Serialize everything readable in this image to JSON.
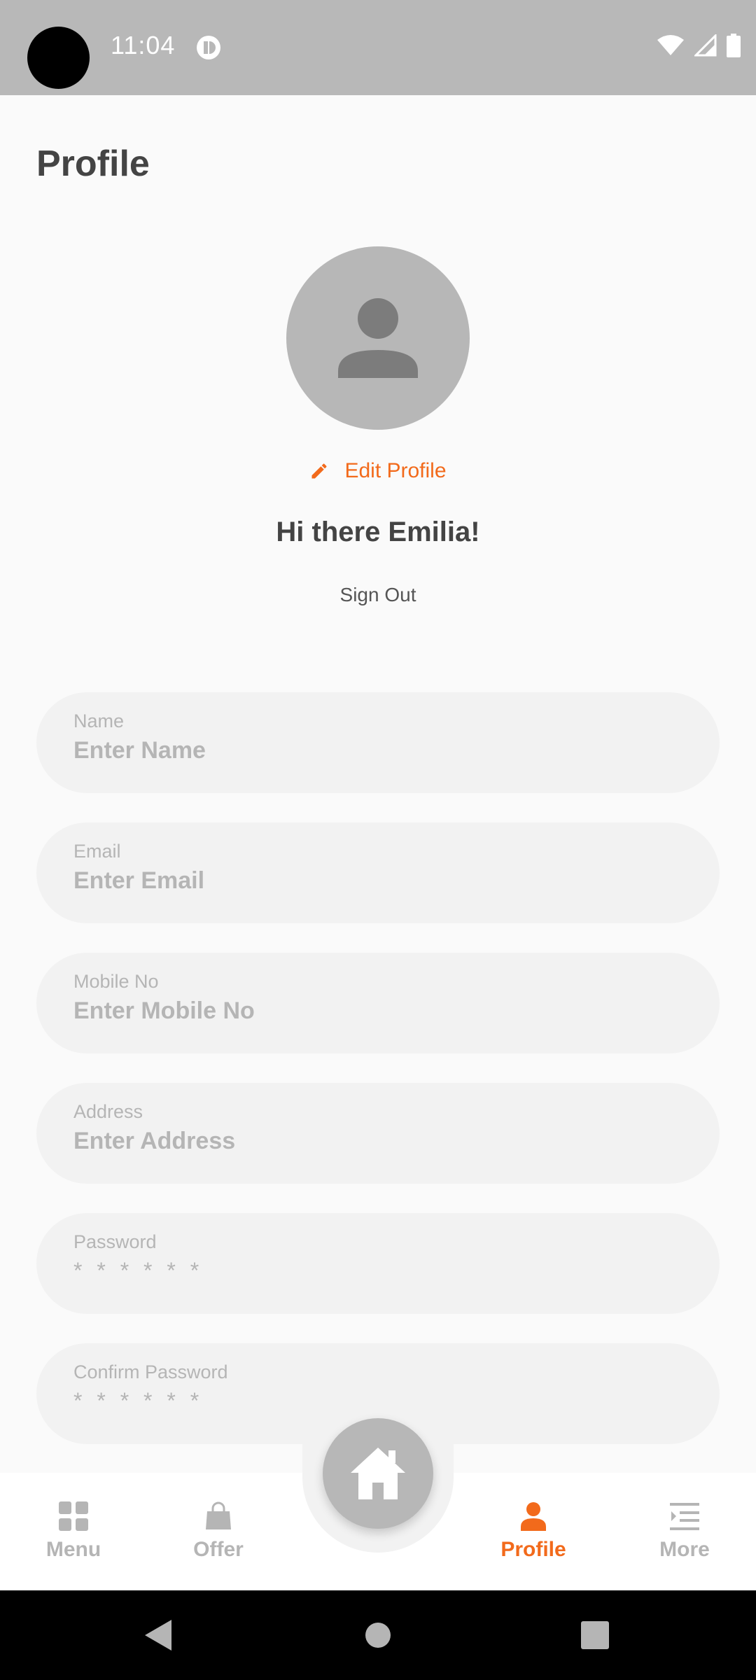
{
  "status_bar": {
    "time": "11:04"
  },
  "header": {
    "title": "Profile"
  },
  "profile": {
    "edit_label": "Edit Profile",
    "greeting": "Hi there Emilia!",
    "sign_out": "Sign Out"
  },
  "form": {
    "fields": [
      {
        "label": "Name",
        "placeholder": "Enter Name"
      },
      {
        "label": "Email",
        "placeholder": "Enter Email"
      },
      {
        "label": "Mobile No",
        "placeholder": "Enter Mobile No"
      },
      {
        "label": "Address",
        "placeholder": "Enter Address"
      },
      {
        "label": "Password",
        "value": "* * * * * *"
      },
      {
        "label": "Confirm Password",
        "value": "* * * * * *"
      }
    ]
  },
  "bottom_nav": {
    "items": [
      {
        "label": "Menu",
        "icon": "grid-icon"
      },
      {
        "label": "Offer",
        "icon": "shopping-bag-icon"
      },
      {
        "label": "Profile",
        "icon": "person-icon",
        "active": true
      },
      {
        "label": "More",
        "icon": "list-menu-icon"
      }
    ],
    "center_icon": "home-icon"
  },
  "colors": {
    "accent": "#F26A1B",
    "status_bar": "#B8B8B8",
    "field_bg": "#F2F2F2",
    "muted": "#B5B5B5"
  }
}
